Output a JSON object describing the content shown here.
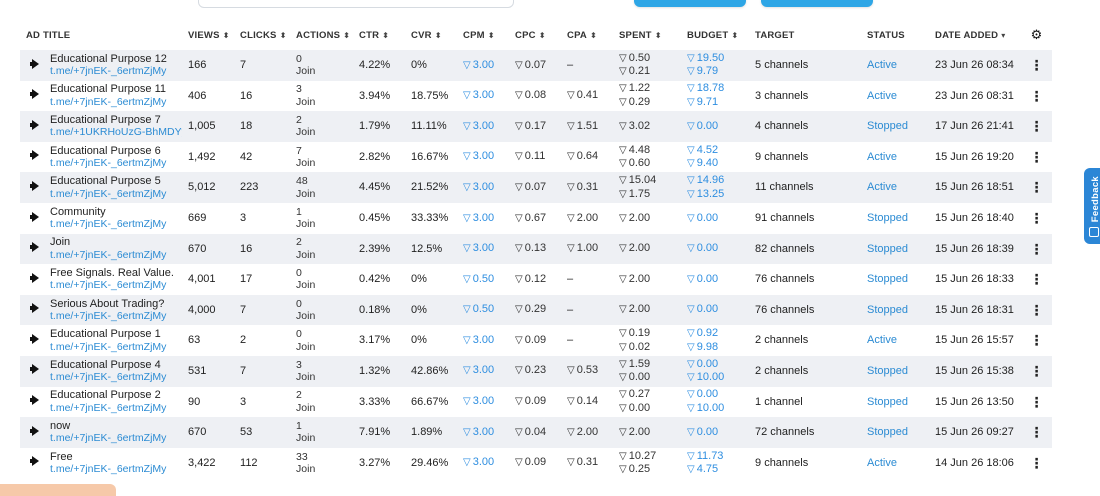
{
  "headers": {
    "ad_title": "AD TITLE",
    "views": "VIEWS",
    "clicks": "CLICKS",
    "actions": "ACTIONS",
    "ctr": "CTR",
    "cvr": "CVR",
    "cpm": "CPM",
    "cpc": "CPC",
    "cpa": "CPA",
    "spent": "SPENT",
    "budget": "BUDGET",
    "target": "TARGET",
    "status": "STATUS",
    "date_added": "DATE ADDED",
    "sort_icon": "⬍",
    "sort_desc_icon": "▾"
  },
  "colors": {
    "accent": "#2b8bd3",
    "row_stripe": "#eef0f4",
    "feedback": "#2b86d6"
  },
  "feedback_label": "Feedback",
  "rows": [
    {
      "title": "Educational Purpose 12",
      "link": "t.me/+7jnEK-_6ertmZjMy",
      "views": "166",
      "clicks": "7",
      "actions": "0",
      "action_label": "Join",
      "ctr": "4.22%",
      "cvr": "0%",
      "cpm": "3.00",
      "cpc": "0.07",
      "cpa": "–",
      "spent": "0.50",
      "spent2": "0.21",
      "budget": "19.50",
      "budget2": "9.79",
      "target": "5 channels",
      "status": "Active",
      "date": "23 Jun 26 08:34"
    },
    {
      "title": "Educational Purpose 11",
      "link": "t.me/+7jnEK-_6ertmZjMy",
      "views": "406",
      "clicks": "16",
      "actions": "3",
      "action_label": "Join",
      "ctr": "3.94%",
      "cvr": "18.75%",
      "cpm": "3.00",
      "cpc": "0.08",
      "cpa": "0.41",
      "spent": "1.22",
      "spent2": "0.29",
      "budget": "18.78",
      "budget2": "9.71",
      "target": "3 channels",
      "status": "Active",
      "date": "23 Jun 26 08:31"
    },
    {
      "title": "Educational Purpose 7",
      "link": "t.me/+1UKRHoUzG-BhMDYy",
      "views": "1,005",
      "clicks": "18",
      "actions": "2",
      "action_label": "Join",
      "ctr": "1.79%",
      "cvr": "11.11%",
      "cpm": "3.00",
      "cpc": "0.17",
      "cpa": "1.51",
      "spent": "3.02",
      "spent2": "",
      "budget": "0.00",
      "budget2": "",
      "target": "4 channels",
      "status": "Stopped",
      "date": "17 Jun 26 21:41"
    },
    {
      "title": "Educational Purpose 6",
      "link": "t.me/+7jnEK-_6ertmZjMy",
      "views": "1,492",
      "clicks": "42",
      "actions": "7",
      "action_label": "Join",
      "ctr": "2.82%",
      "cvr": "16.67%",
      "cpm": "3.00",
      "cpc": "0.11",
      "cpa": "0.64",
      "spent": "4.48",
      "spent2": "0.60",
      "budget": "4.52",
      "budget2": "9.40",
      "target": "9 channels",
      "status": "Active",
      "date": "15 Jun 26 19:20"
    },
    {
      "title": "Educational Purpose 5",
      "link": "t.me/+7jnEK-_6ertmZjMy",
      "views": "5,012",
      "clicks": "223",
      "actions": "48",
      "action_label": "Join",
      "ctr": "4.45%",
      "cvr": "21.52%",
      "cpm": "3.00",
      "cpc": "0.07",
      "cpa": "0.31",
      "spent": "15.04",
      "spent2": "1.75",
      "budget": "14.96",
      "budget2": "13.25",
      "target": "11 channels",
      "status": "Active",
      "date": "15 Jun 26 18:51"
    },
    {
      "title": "Community",
      "link": "t.me/+7jnEK-_6ertmZjMy",
      "views": "669",
      "clicks": "3",
      "actions": "1",
      "action_label": "Join",
      "ctr": "0.45%",
      "cvr": "33.33%",
      "cpm": "3.00",
      "cpc": "0.67",
      "cpa": "2.00",
      "spent": "2.00",
      "spent2": "",
      "budget": "0.00",
      "budget2": "",
      "target": "91 channels",
      "status": "Stopped",
      "date": "15 Jun 26 18:40"
    },
    {
      "title": "Join",
      "link": "t.me/+7jnEK-_6ertmZjMy",
      "views": "670",
      "clicks": "16",
      "actions": "2",
      "action_label": "Join",
      "ctr": "2.39%",
      "cvr": "12.5%",
      "cpm": "3.00",
      "cpc": "0.13",
      "cpa": "1.00",
      "spent": "2.00",
      "spent2": "",
      "budget": "0.00",
      "budget2": "",
      "target": "82 channels",
      "status": "Stopped",
      "date": "15 Jun 26 18:39"
    },
    {
      "title": "Free Signals. Real Value.",
      "link": "t.me/+7jnEK-_6ertmZjMy",
      "views": "4,001",
      "clicks": "17",
      "actions": "0",
      "action_label": "Join",
      "ctr": "0.42%",
      "cvr": "0%",
      "cpm": "0.50",
      "cpc": "0.12",
      "cpa": "–",
      "spent": "2.00",
      "spent2": "",
      "budget": "0.00",
      "budget2": "",
      "target": "76 channels",
      "status": "Stopped",
      "date": "15 Jun 26 18:33"
    },
    {
      "title": "Serious About Trading?",
      "link": "t.me/+7jnEK-_6ertmZjMy",
      "views": "4,000",
      "clicks": "7",
      "actions": "0",
      "action_label": "Join",
      "ctr": "0.18%",
      "cvr": "0%",
      "cpm": "0.50",
      "cpc": "0.29",
      "cpa": "–",
      "spent": "2.00",
      "spent2": "",
      "budget": "0.00",
      "budget2": "",
      "target": "76 channels",
      "status": "Stopped",
      "date": "15 Jun 26 18:31"
    },
    {
      "title": "Educational Purpose 1",
      "link": "t.me/+7jnEK-_6ertmZjMy",
      "views": "63",
      "clicks": "2",
      "actions": "0",
      "action_label": "Join",
      "ctr": "3.17%",
      "cvr": "0%",
      "cpm": "3.00",
      "cpc": "0.09",
      "cpa": "–",
      "spent": "0.19",
      "spent2": "0.02",
      "budget": "0.92",
      "budget2": "9.98",
      "target": "2 channels",
      "status": "Active",
      "date": "15 Jun 26 15:57"
    },
    {
      "title": "Educational Purpose 4",
      "link": "t.me/+7jnEK-_6ertmZjMy",
      "views": "531",
      "clicks": "7",
      "actions": "3",
      "action_label": "Join",
      "ctr": "1.32%",
      "cvr": "42.86%",
      "cpm": "3.00",
      "cpc": "0.23",
      "cpa": "0.53",
      "spent": "1.59",
      "spent2": "0.00",
      "budget": "0.00",
      "budget2": "10.00",
      "target": "2 channels",
      "status": "Stopped",
      "date": "15 Jun 26 15:38"
    },
    {
      "title": "Educational Purpose 2",
      "link": "t.me/+7jnEK-_6ertmZjMy",
      "views": "90",
      "clicks": "3",
      "actions": "2",
      "action_label": "Join",
      "ctr": "3.33%",
      "cvr": "66.67%",
      "cpm": "3.00",
      "cpc": "0.09",
      "cpa": "0.14",
      "spent": "0.27",
      "spent2": "0.00",
      "budget": "0.00",
      "budget2": "10.00",
      "target": "1 channel",
      "status": "Stopped",
      "date": "15 Jun 26 13:50"
    },
    {
      "title": "now",
      "link": "t.me/+7jnEK-_6ertmZjMy",
      "views": "670",
      "clicks": "53",
      "actions": "1",
      "action_label": "Join",
      "ctr": "7.91%",
      "cvr": "1.89%",
      "cpm": "3.00",
      "cpc": "0.04",
      "cpa": "2.00",
      "spent": "2.00",
      "spent2": "",
      "budget": "0.00",
      "budget2": "",
      "target": "72 channels",
      "status": "Stopped",
      "date": "15 Jun 26 09:27"
    },
    {
      "title": "Free",
      "link": "t.me/+7jnEK-_6ertmZjMy",
      "views": "3,422",
      "clicks": "112",
      "actions": "33",
      "action_label": "Join",
      "ctr": "3.27%",
      "cvr": "29.46%",
      "cpm": "3.00",
      "cpc": "0.09",
      "cpa": "0.31",
      "spent": "10.27",
      "spent2": "0.25",
      "budget": "11.73",
      "budget2": "4.75",
      "target": "9 channels",
      "status": "Active",
      "date": "14 Jun 26 18:06"
    }
  ]
}
